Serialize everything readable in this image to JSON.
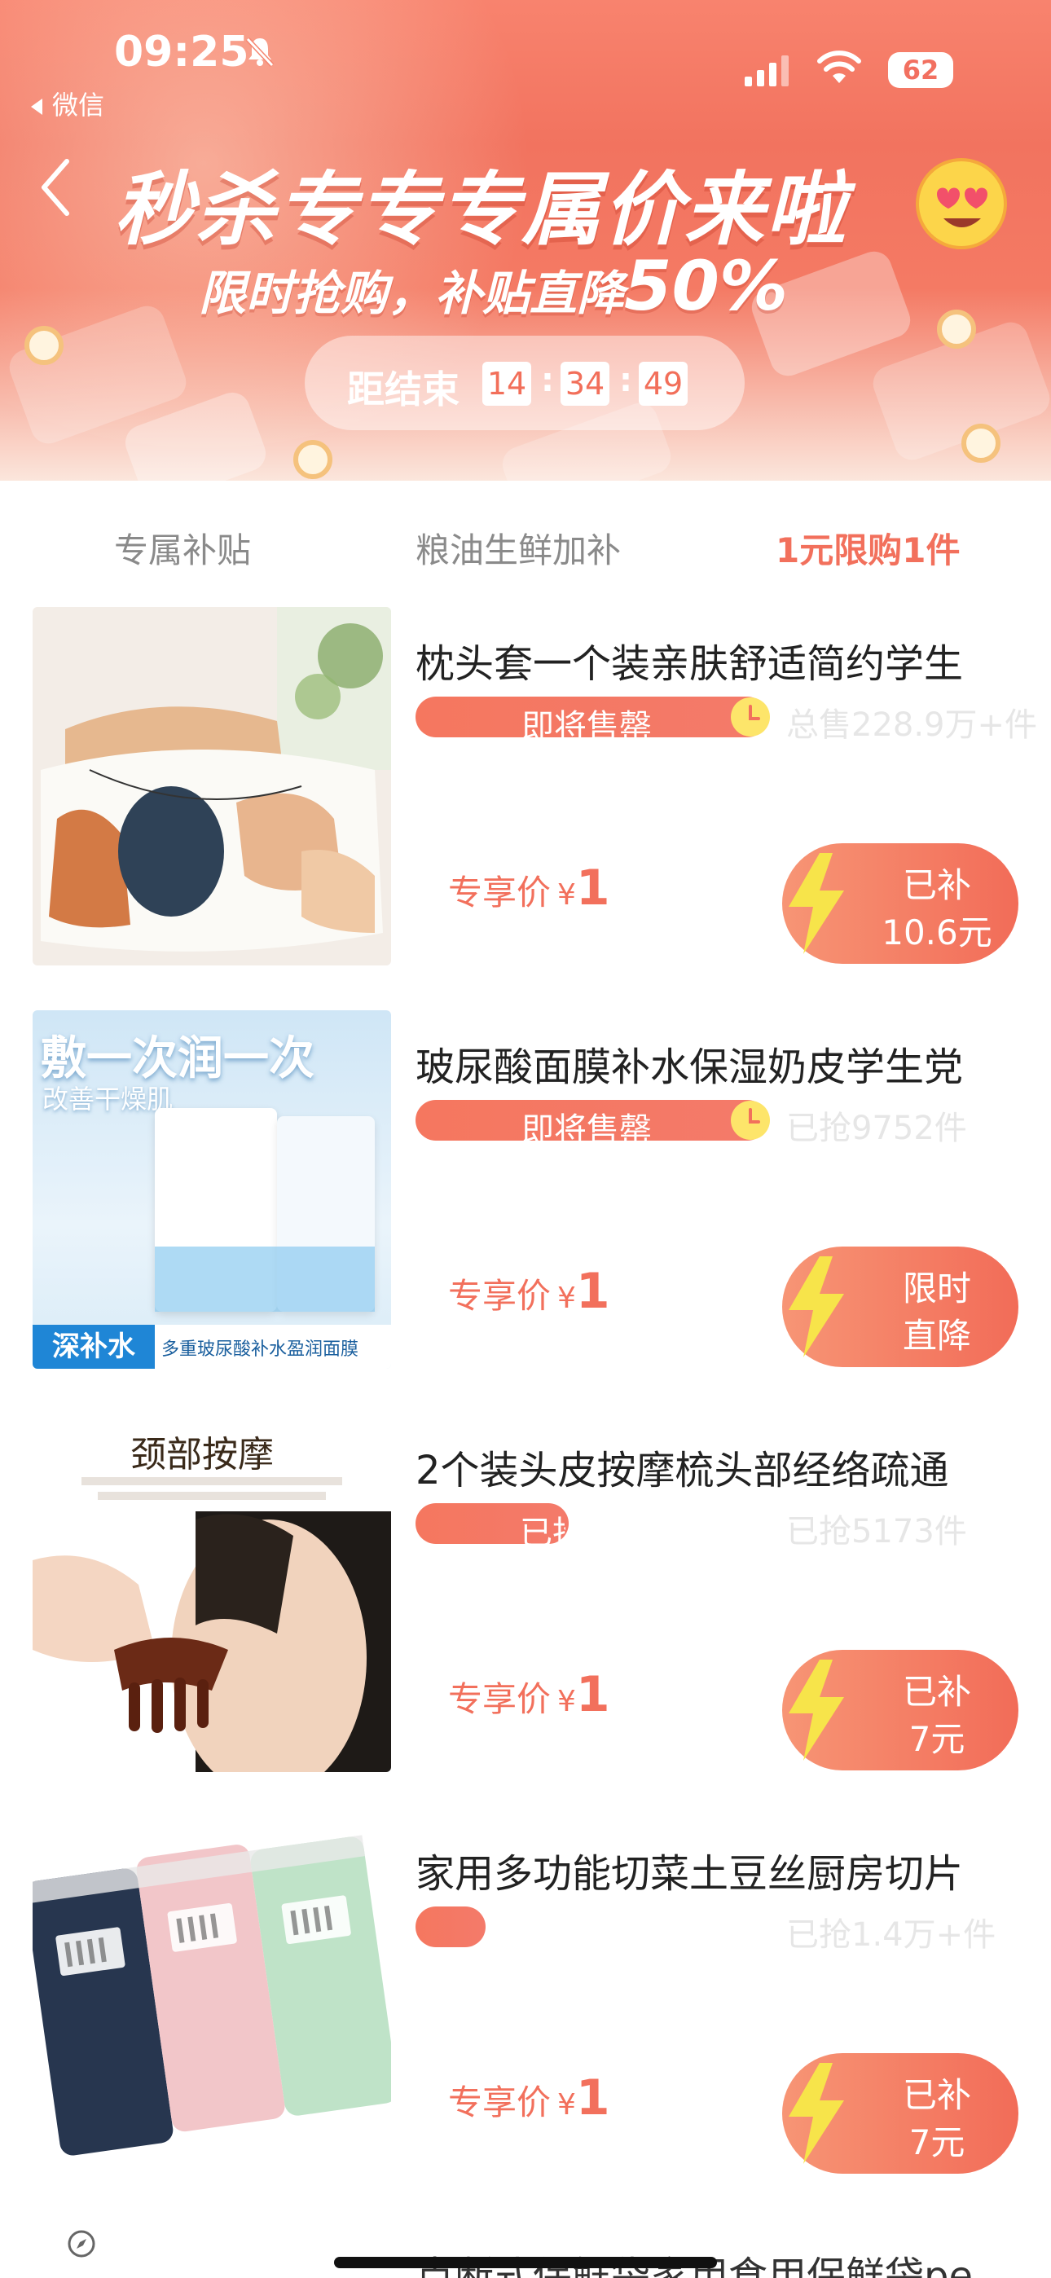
{
  "status_bar": {
    "time": "09:25",
    "back_app": "微信",
    "battery": "62"
  },
  "hero": {
    "title": "秒杀专专专属价来啦",
    "subtitle_main": "限时抢购，补贴直降",
    "subtitle_pct": "50%",
    "countdown_label": "距结束",
    "countdown_h": "14",
    "countdown_m": "34",
    "countdown_s": "49",
    "colon": ":"
  },
  "tabs": [
    {
      "label": "专属补贴"
    },
    {
      "label": "粮油生鲜加补"
    },
    {
      "label": "1元限购1件"
    }
  ],
  "products": [
    {
      "title": "枕头套一个装亲肤舒适简约学生",
      "stock_text": "即将售罄",
      "sold": "总售228.9万+件",
      "price_label": "专享价",
      "currency": "¥",
      "price": "1",
      "subsidy_line1": "已补",
      "subsidy_line2": "10.6元"
    },
    {
      "title": "玻尿酸面膜补水保湿奶皮学生党",
      "stock_text": "即将售罄",
      "sold": "已抢9752件",
      "price_label": "专享价",
      "currency": "¥",
      "price": "1",
      "subsidy_line1": "限时",
      "subsidy_line2": "直降",
      "image_text1": "敷一次润一次",
      "image_text2": "改善干燥肌",
      "image_text3": "深补水",
      "image_text4": "多重玻尿酸补水盈润面膜"
    },
    {
      "title": "2个装头皮按摩梳头部经络疏通",
      "stock_text": "已抢",
      "sold": "已抢5173件",
      "price_label": "专享价",
      "currency": "¥",
      "price": "1",
      "subsidy_line1": "已补",
      "subsidy_line2": "7元",
      "image_text1": "颈部按摩"
    },
    {
      "title": "家用多功能切菜土豆丝厨房切片",
      "stock_text": "",
      "sold": "已抢1.4万+件",
      "price_label": "专享价",
      "currency": "¥",
      "price": "1",
      "subsidy_line1": "已补",
      "subsidy_line2": "7元"
    }
  ],
  "next_product_title": "点断式保鲜袋家用食用保鲜袋pe",
  "colors": {
    "accent": "#f2705c",
    "bolt": "#f7e44a"
  }
}
